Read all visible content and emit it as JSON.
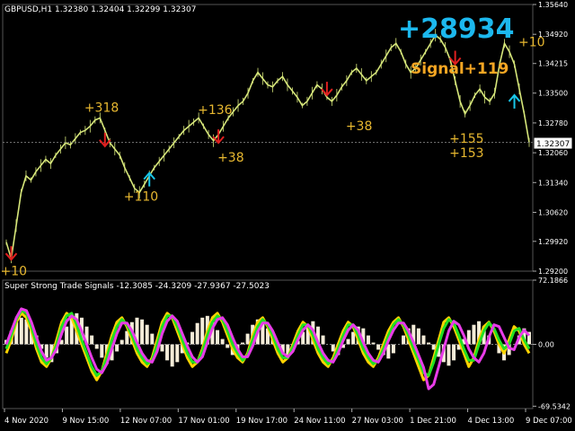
{
  "symbol_header": "GBPUSD,H1  1.32380 1.32404 1.32299 1.32307",
  "indicator_header": "Super Strong Trade Signals -12.3085 -24.3209 -27.9367 -27.5023",
  "big_profit": "+28934",
  "signal_label": "Signal+119",
  "current_price": "1.32307",
  "colors": {
    "background": "#000000",
    "price_line": "#d6e67a",
    "sell_arrow": "#e02020",
    "buy_arrow": "#19c6e8",
    "trade_label": "#e8b830",
    "big_profit": "#1cb8ee",
    "signal": "#f5a623",
    "osc_yellow": "#ffd400",
    "osc_green": "#22e022",
    "osc_magenta": "#e83ce8",
    "osc_histogram": "#f4ecd8"
  },
  "chart_data": [
    {
      "type": "line",
      "title": "",
      "ylim": [
        1.292,
        1.3564
      ],
      "y_ticks": [
        "1.35640",
        "1.34920",
        "1.34215",
        "1.33500",
        "1.32780",
        "1.32060",
        "1.31340",
        "1.30620",
        "1.29920",
        "1.29200"
      ],
      "series": [
        {
          "values": [
            1.299,
            1.295,
            1.303,
            1.311,
            1.315,
            1.314,
            1.316,
            1.3175,
            1.319,
            1.318,
            1.32,
            1.3215,
            1.323,
            1.3225,
            1.324,
            1.3255,
            1.326,
            1.327,
            1.3285,
            1.329,
            1.326,
            1.323,
            1.3215,
            1.32,
            1.317,
            1.3145,
            1.312,
            1.311,
            1.313,
            1.315,
            1.317,
            1.3185,
            1.32,
            1.3215,
            1.323,
            1.3245,
            1.326,
            1.327,
            1.328,
            1.329,
            1.327,
            1.325,
            1.3235,
            1.325,
            1.327,
            1.329,
            1.3305,
            1.332,
            1.333,
            1.335,
            1.338,
            1.34,
            1.3385,
            1.337,
            1.3365,
            1.338,
            1.339,
            1.337,
            1.3355,
            1.334,
            1.332,
            1.333,
            1.335,
            1.337,
            1.336,
            1.334,
            1.333,
            1.3345,
            1.3365,
            1.338,
            1.34,
            1.341,
            1.3395,
            1.338,
            1.339,
            1.34,
            1.342,
            1.344,
            1.346,
            1.347,
            1.345,
            1.342,
            1.34,
            1.341,
            1.343,
            1.345,
            1.347,
            1.349,
            1.348,
            1.346,
            1.343,
            1.338,
            1.333,
            1.33,
            1.332,
            1.3345,
            1.336,
            1.334,
            1.333,
            1.335,
            1.342,
            1.347,
            1.345,
            1.342,
            1.336,
            1.33,
            1.3231
          ]
        }
      ],
      "trade_labels": [
        {
          "text": "+318",
          "index": 18,
          "price": 1.3305
        },
        {
          "text": "+110",
          "index": 26,
          "price": 1.309
        },
        {
          "text": "+136",
          "index": 41,
          "price": 1.33
        },
        {
          "text": "+38",
          "index": 45,
          "price": 1.3185
        },
        {
          "text": "+38",
          "index": 71,
          "price": 1.326
        },
        {
          "text": "+155",
          "index": 92,
          "price": 1.323
        },
        {
          "text": "+153",
          "index": 92,
          "price": 1.3195
        },
        {
          "text": "+10",
          "index": 106,
          "price": 1.3463
        },
        {
          "text": "+10",
          "index": 1,
          "price": 1.291
        }
      ],
      "sell_arrows": [
        {
          "index": 20,
          "price": 1.3237
        },
        {
          "index": 43,
          "price": 1.3245
        },
        {
          "index": 65,
          "price": 1.336
        },
        {
          "index": 91,
          "price": 1.3435
        },
        {
          "index": 1,
          "price": 1.2963
        }
      ],
      "buy_arrows": [
        {
          "index": 29,
          "price": 1.3142
        },
        {
          "index": 103,
          "price": 1.333
        }
      ]
    },
    {
      "type": "line",
      "title": "",
      "ylim": [
        -72.1866,
        72.1866
      ],
      "y_ticks": [
        "72.1866",
        "0.00",
        "-69.5342"
      ],
      "x_ticks": [
        "4 Nov 2020",
        "9 Nov 15:00",
        "12 Nov 07:00",
        "17 Nov 01:00",
        "19 Nov 17:00",
        "24 Nov 11:00",
        "27 Nov 03:00",
        "1 Dec 21:00",
        "4 Dec 13:00",
        "9 Dec 07:00"
      ],
      "histogram": [
        5,
        15,
        25,
        30,
        28,
        20,
        10,
        -5,
        -15,
        -20,
        -10,
        5,
        20,
        30,
        35,
        30,
        20,
        10,
        -5,
        -15,
        -22,
        -18,
        -8,
        5,
        15,
        25,
        30,
        28,
        22,
        12,
        2,
        -8,
        -18,
        -25,
        -20,
        -10,
        2,
        14,
        24,
        30,
        32,
        26,
        16,
        6,
        -4,
        -12,
        -8,
        2,
        12,
        22,
        28,
        26,
        18,
        8,
        -2,
        -10,
        -14,
        -6,
        4,
        14,
        22,
        26,
        20,
        10,
        0,
        -8,
        -12,
        -4,
        6,
        14,
        20,
        18,
        10,
        2,
        -6,
        -12,
        -16,
        -10,
        0,
        10,
        18,
        22,
        18,
        10,
        2,
        -6,
        -14,
        -20,
        -24,
        -18,
        -6,
        6,
        16,
        22,
        26,
        20,
        10,
        0,
        -10,
        -18,
        -12,
        0,
        10,
        18,
        14
      ],
      "series": [
        {
          "values": [
            -10,
            5,
            25,
            35,
            30,
            15,
            -5,
            -20,
            -25,
            -15,
            5,
            25,
            35,
            30,
            15,
            0,
            -15,
            -30,
            -40,
            -30,
            -10,
            10,
            25,
            30,
            20,
            5,
            -10,
            -20,
            -25,
            -15,
            5,
            25,
            35,
            30,
            15,
            0,
            -15,
            -25,
            -20,
            -5,
            15,
            30,
            35,
            25,
            10,
            -5,
            -15,
            -20,
            -10,
            10,
            25,
            30,
            20,
            5,
            -10,
            -20,
            -15,
            0,
            15,
            25,
            20,
            5,
            -10,
            -20,
            -25,
            -15,
            0,
            15,
            25,
            20,
            5,
            -10,
            -20,
            -25,
            -15,
            0,
            15,
            25,
            30,
            20,
            5,
            -10,
            -25,
            -40,
            -35,
            -15,
            5,
            25,
            30,
            20,
            5,
            -10,
            -25,
            -15,
            5,
            20,
            25,
            15,
            0,
            -10,
            5,
            20,
            15,
            0,
            -10
          ]
        },
        {
          "values": [
            -5,
            10,
            28,
            38,
            35,
            20,
            0,
            -15,
            -22,
            -15,
            0,
            20,
            32,
            35,
            22,
            5,
            -10,
            -25,
            -35,
            -30,
            -15,
            5,
            20,
            28,
            22,
            10,
            -5,
            -15,
            -22,
            -18,
            0,
            20,
            32,
            32,
            20,
            5,
            -10,
            -20,
            -20,
            -8,
            10,
            25,
            32,
            28,
            15,
            0,
            -10,
            -18,
            -12,
            5,
            20,
            28,
            22,
            10,
            -5,
            -15,
            -15,
            -3,
            10,
            22,
            22,
            10,
            -5,
            -15,
            -22,
            -18,
            -5,
            10,
            22,
            22,
            10,
            -5,
            -15,
            -22,
            -18,
            -5,
            10,
            22,
            28,
            22,
            10,
            -5,
            -18,
            -32,
            -35,
            -20,
            0,
            18,
            28,
            24,
            10,
            -5,
            -18,
            -18,
            0,
            15,
            24,
            18,
            5,
            -5,
            0,
            15,
            18,
            5,
            -5
          ]
        },
        {
          "values": [
            0,
            15,
            30,
            40,
            38,
            25,
            8,
            -8,
            -18,
            -15,
            -5,
            12,
            26,
            32,
            28,
            15,
            0,
            -15,
            -28,
            -32,
            -22,
            -5,
            12,
            24,
            24,
            15,
            2,
            -10,
            -18,
            -20,
            -8,
            12,
            26,
            32,
            26,
            12,
            -2,
            -14,
            -20,
            -14,
            2,
            18,
            28,
            30,
            22,
            8,
            -5,
            -14,
            -14,
            -2,
            14,
            24,
            24,
            15,
            2,
            -10,
            -14,
            -8,
            5,
            16,
            22,
            16,
            2,
            -10,
            -18,
            -20,
            -10,
            4,
            16,
            22,
            16,
            2,
            -10,
            -18,
            -20,
            -10,
            4,
            16,
            24,
            24,
            15,
            2,
            -12,
            -26,
            -50,
            -45,
            -25,
            -5,
            15,
            26,
            22,
            10,
            -5,
            -15,
            -20,
            -10,
            8,
            22,
            20,
            8,
            -4,
            -6,
            8,
            16,
            10
          ]
        }
      ]
    }
  ]
}
